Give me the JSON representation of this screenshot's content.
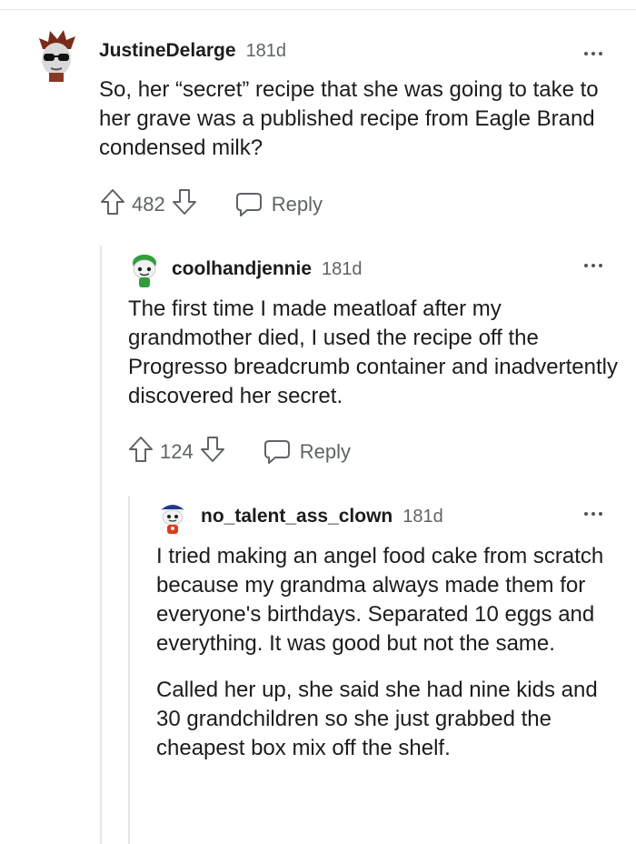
{
  "comments": [
    {
      "username": "JustineDelarge",
      "age": "181d",
      "body": [
        "So, her “secret” recipe that she was going to take to her grave was a published recipe from Eagle Brand condensed milk?"
      ],
      "votes": "482",
      "reply_label": "Reply",
      "avatar_icon": "sunglasses-avatar-icon"
    },
    {
      "username": "coolhandjennie",
      "age": "181d",
      "body": [
        "The first time I made meatloaf after my grandmother died, I used the recipe off the Progresso breadcrumb container and inadvertently discovered her secret."
      ],
      "votes": "124",
      "reply_label": "Reply",
      "avatar_icon": "green-snoo-avatar-icon"
    },
    {
      "username": "no_talent_ass_clown",
      "age": "181d",
      "body": [
        "I tried making an angel food cake from scratch because my grandma always made them for everyone's birthdays. Separated 10 eggs and everything. It was good but not the same.",
        "Called her up, she said she had nine kids and 30 grandchildren so she just grabbed the cheapest box mix off the shelf."
      ],
      "avatar_icon": "sailor-snoo-avatar-icon"
    }
  ],
  "colors": {
    "text": "#1c1c1c",
    "meta": "#5f6368",
    "thread_line": "#e6e6e6"
  }
}
